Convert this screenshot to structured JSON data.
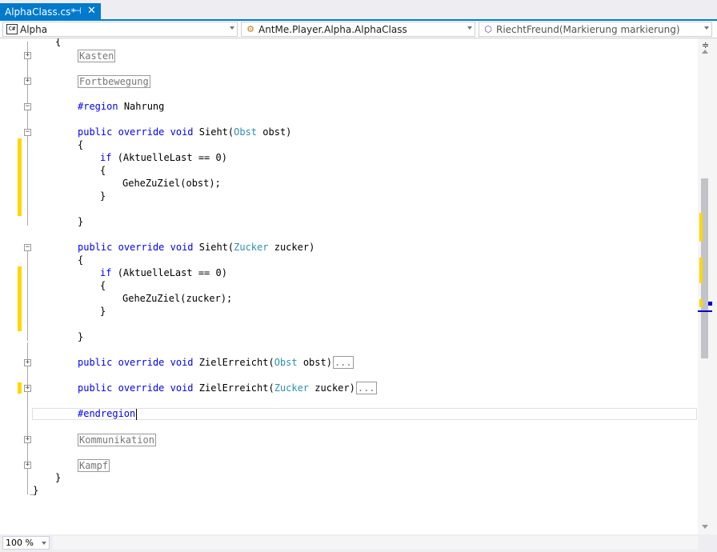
{
  "tab": {
    "title": "AlphaClass.cs*",
    "pin_glyph": "⊣",
    "close_glyph": "✕"
  },
  "nav": {
    "project": "Alpha",
    "project_icon": "C#",
    "class": "AntMe.Player.Alpha.AlphaClass",
    "member": "RiechtFreund(Markierung markierung)"
  },
  "code": {
    "l01": "{",
    "region_kasten": "Kasten",
    "region_fortbewegung": "Fortbewegung",
    "region_nahrung_kw": "#region",
    "region_nahrung_name": "Nahrung",
    "m1_public": "public",
    "m1_override": "override",
    "m1_void": "void",
    "m1_name": "Sieht(",
    "m1_type": "Obst",
    "m1_param": "obst)",
    "open_brace": "{",
    "if_kw": "if",
    "if_cond": "(AktuelleLast == 0)",
    "inner_open": "{",
    "call1": "GeheZuZiel(obst);",
    "inner_close": "}",
    "close_brace": "}",
    "m2_name": "Sieht(",
    "m2_type": "Zucker",
    "m2_param": "zucker)",
    "call2": "GeheZuZiel(zucker);",
    "m3_name": "ZielErreicht(",
    "m3_type": "Obst",
    "m3_param": "obst)",
    "m4_name": "ZielErreicht(",
    "m4_type": "Zucker",
    "m4_param": "zucker)",
    "ellipsis": "...",
    "endregion": "#endregion",
    "region_kommunikation": "Kommunikation",
    "region_kampf": "Kampf",
    "class_close": "}",
    "ns_close": "}"
  },
  "status": {
    "zoom": "100 %"
  },
  "colors": {
    "accent": "#007acc",
    "keyword": "#0000ff",
    "type": "#2b91af",
    "change_marker": "#ffd700"
  }
}
